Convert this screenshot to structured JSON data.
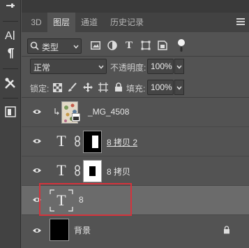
{
  "panel_tabs": [
    {
      "label": "3D",
      "active": false
    },
    {
      "label": "图层",
      "active": true
    },
    {
      "label": "通道",
      "active": false
    },
    {
      "label": "历史记录",
      "active": false
    }
  ],
  "filter": {
    "kind_label": "类型"
  },
  "blend": {
    "mode": "正常",
    "opacity_label": "不透明度:",
    "opacity_value": "100%"
  },
  "lock": {
    "label": "锁定:",
    "fill_label": "填充:",
    "fill_value": "100%"
  },
  "layers": [
    {
      "name": "_MG_4508",
      "type": "image",
      "clipped": true
    },
    {
      "name": "8 拷贝 2",
      "type": "text",
      "has_mask": true,
      "underlined": true
    },
    {
      "name": "8 拷贝",
      "type": "text",
      "has_mask": true
    },
    {
      "name": "8",
      "type": "text",
      "selected": true
    },
    {
      "name": "背景",
      "type": "background",
      "locked": true
    }
  ],
  "colors": {
    "panel_bg": "#535353",
    "selected_bg": "#6b6b6b",
    "highlight": "#d4333c"
  }
}
